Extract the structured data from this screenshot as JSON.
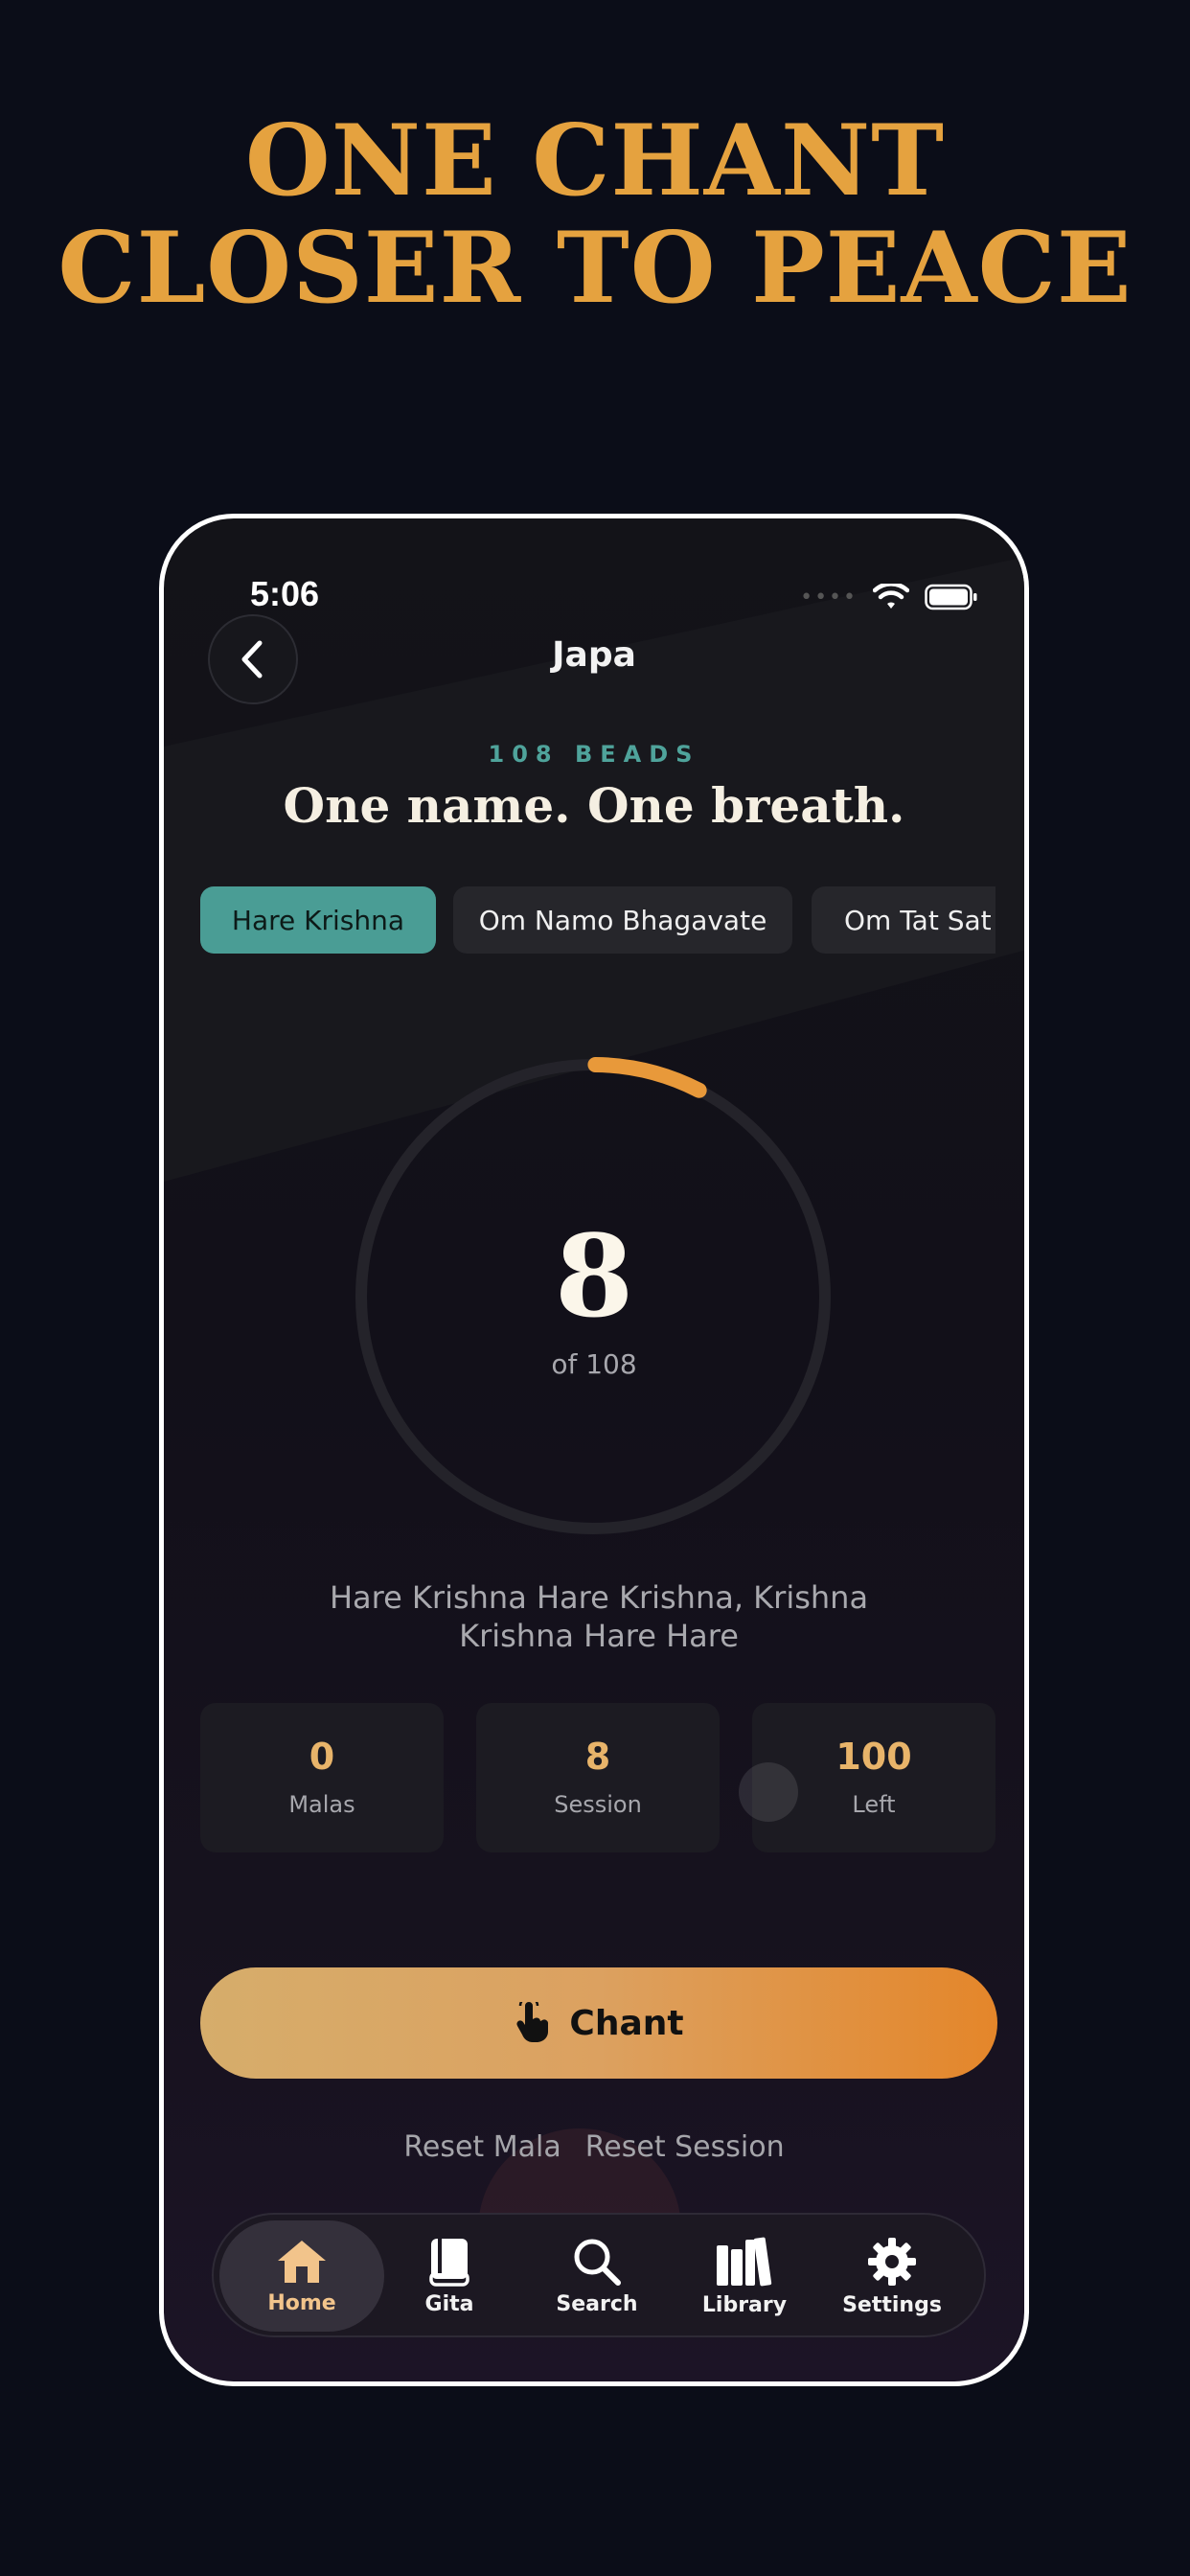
{
  "headline": {
    "line1": "ONE CHANT",
    "line2": "CLOSER TO PEACE"
  },
  "status": {
    "time": "5:06"
  },
  "nav": {
    "title": "Japa",
    "back_icon": "chevron-left-icon"
  },
  "hero": {
    "eyebrow": "108 BEADS",
    "subtitle": "One name. One breath."
  },
  "mantras": {
    "selected": "Hare Krishna",
    "chips": [
      "Hare Krishna",
      "Om Namo Bhagavate",
      "Om Tat Sat"
    ]
  },
  "counter": {
    "count": "8",
    "of_label": "of 108",
    "progress": 0.074
  },
  "mantra_text": "Hare Krishna Hare Krishna, Krishna Krishna Hare Hare",
  "stats": [
    {
      "value": "0",
      "label": "Malas"
    },
    {
      "value": "8",
      "label": "Session"
    },
    {
      "value": "100",
      "label": "Left"
    }
  ],
  "actions": {
    "chant": "Chant",
    "chant_icon": "tap-hand-icon",
    "reset_mala": "Reset Mala",
    "reset_session": "Reset Session"
  },
  "tabs": [
    {
      "label": "Home",
      "icon": "home-icon",
      "active": true
    },
    {
      "label": "Gita",
      "icon": "book-icon",
      "active": false
    },
    {
      "label": "Search",
      "icon": "search-icon",
      "active": false
    },
    {
      "label": "Library",
      "icon": "library-icon",
      "active": false
    },
    {
      "label": "Settings",
      "icon": "gear-icon",
      "active": false
    }
  ],
  "colors": {
    "background": "#0b0d18",
    "headline": "#e5a23f",
    "accent_teal": "#4a9d95",
    "progress": "#e8993a",
    "stat_value": "#e8b46a",
    "tab_active_label": "#f2c48b"
  }
}
